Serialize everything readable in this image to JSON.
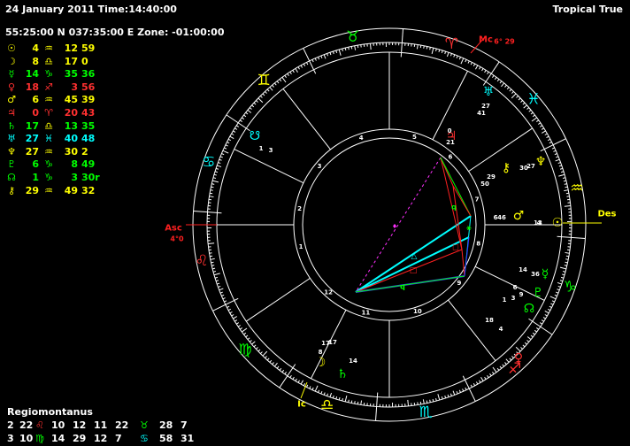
{
  "header": {
    "date_time": "24 January 2011 Time:14:40:00",
    "location": "55:25:00 N 037:35:00 E Zone: -01:00:00",
    "zodiac_mode": "Tropical True"
  },
  "colors": {
    "sun": "#ffff00",
    "moon": "#ffff00",
    "mercury": "#00ff00",
    "venus": "#ff3030",
    "mars": "#ffff00",
    "jupiter": "#ff3030",
    "saturn": "#00ff00",
    "uranus": "#00ffff",
    "neptune": "#ffff00",
    "pluto": "#00ff00",
    "node": "#00ff00",
    "chiron": "#ffff00",
    "fire": "#ff3030",
    "earth": "#00ff00",
    "air": "#ffff00",
    "water": "#00ffff",
    "aspect_cyan": "#00ffff",
    "aspect_red": "#ff2020",
    "aspect_blue": "#3030ff",
    "aspect_green": "#00ff00",
    "aspect_magenta": "#ff30ff"
  },
  "planets": [
    {
      "glyph": "☉",
      "deg": "4",
      "sign": "♒",
      "min": "12",
      "sec": "59",
      "color": "#ffff00",
      "sign_color": "#ffff00"
    },
    {
      "glyph": "☽",
      "deg": "8",
      "sign": "♎",
      "min": "17",
      "sec": "0",
      "color": "#ffff00",
      "sign_color": "#ffff00"
    },
    {
      "glyph": "☿",
      "deg": "14",
      "sign": "♑",
      "min": "35",
      "sec": "36",
      "color": "#00ff00",
      "sign_color": "#00ff00"
    },
    {
      "glyph": "♀",
      "deg": "18",
      "sign": "♐",
      "min": "3",
      "sec": "56",
      "color": "#ff3030",
      "sign_color": "#ff3030"
    },
    {
      "glyph": "♂",
      "deg": "6",
      "sign": "♒",
      "min": "45",
      "sec": "39",
      "color": "#ffff00",
      "sign_color": "#ffff00"
    },
    {
      "glyph": "♃",
      "deg": "0",
      "sign": "♈",
      "min": "20",
      "sec": "43",
      "color": "#ff3030",
      "sign_color": "#ff3030"
    },
    {
      "glyph": "♄",
      "deg": "17",
      "sign": "♎",
      "min": "13",
      "sec": "35",
      "color": "#00ff00",
      "sign_color": "#ffff00"
    },
    {
      "glyph": "♅",
      "deg": "27",
      "sign": "♓",
      "min": "40",
      "sec": "48",
      "color": "#00ffff",
      "sign_color": "#00ffff"
    },
    {
      "glyph": "♆",
      "deg": "27",
      "sign": "♒",
      "min": "30",
      "sec": "2",
      "color": "#ffff00",
      "sign_color": "#ffff00"
    },
    {
      "glyph": "♇",
      "deg": "6",
      "sign": "♑",
      "min": "8",
      "sec": "49",
      "color": "#00ff00",
      "sign_color": "#00ff00"
    },
    {
      "glyph": "☊",
      "deg": "1",
      "sign": "♑",
      "min": "3",
      "sec": "30r",
      "color": "#00ff00",
      "sign_color": "#00ff00"
    },
    {
      "glyph": "⚷",
      "deg": "29",
      "sign": "♒",
      "min": "49",
      "sec": "32",
      "color": "#ffff00",
      "sign_color": "#ffff00"
    }
  ],
  "house_system": "Regiomontanus",
  "house_cusps": [
    {
      "a_num": "2",
      "a_deg": "22",
      "a_sign": "♌",
      "a_min": "10",
      "a_sign_color": "#ff3030",
      "b_num": "12",
      "b_deg": "11",
      "b_min": "22",
      "b_sign": "♉",
      "b_deg2": "28",
      "b_min2": "7",
      "b_sign_color": "#00ff00"
    },
    {
      "a_num": "3",
      "a_deg": "10",
      "a_sign": "♍",
      "a_min": "14",
      "a_sign_color": "#00ff00",
      "b_num": "29",
      "b_deg": "12",
      "b_min": "7",
      "b_sign": "♋",
      "b_deg2": "58",
      "b_min2": "31",
      "b_sign_color": "#00ffff"
    }
  ],
  "angles": {
    "asc_label": "Asc",
    "asc_deg": "4°0",
    "mc_label": "Mc",
    "mc_deg": "6° 29",
    "des_label": "Des",
    "ic_label": "Ic"
  },
  "wheel_signs": [
    {
      "glyph": "♉",
      "color": "#00ff00"
    },
    {
      "glyph": "♈",
      "color": "#ff3030"
    },
    {
      "glyph": "♓",
      "color": "#00ffff"
    },
    {
      "glyph": "♒",
      "color": "#ffff00"
    },
    {
      "glyph": "♑",
      "color": "#00ff00"
    },
    {
      "glyph": "♐",
      "color": "#ff3030"
    },
    {
      "glyph": "♏",
      "color": "#00ffff"
    },
    {
      "glyph": "♎",
      "color": "#ffff00"
    },
    {
      "glyph": "♍",
      "color": "#00ff00"
    },
    {
      "glyph": "♌",
      "color": "#ff3030"
    },
    {
      "glyph": "♋",
      "color": "#00ffff"
    },
    {
      "glyph": "♊",
      "color": "#ffff00"
    }
  ],
  "house_numbers": [
    "1",
    "2",
    "3",
    "4",
    "5",
    "6",
    "7",
    "8",
    "9",
    "10",
    "11",
    "12"
  ],
  "wheel_planets": [
    {
      "name": "uranus",
      "glyph": "♅",
      "deg": "27",
      "min": "41",
      "color": "#00ffff"
    },
    {
      "name": "jupiter",
      "glyph": "♃",
      "deg": "0",
      "min": "21",
      "color": "#ff3030"
    },
    {
      "name": "chiron",
      "glyph": "⚷",
      "deg": "29",
      "min": "50",
      "color": "#ffff00"
    },
    {
      "name": "neptune",
      "glyph": "♆",
      "deg": "27",
      "min": "30",
      "color": "#ffff00"
    },
    {
      "name": "mars",
      "glyph": "♂",
      "deg": "6",
      "min": "46",
      "color": "#ffff00"
    },
    {
      "name": "sun",
      "glyph": "☉",
      "deg": "4",
      "min": "13",
      "color": "#ffff00"
    },
    {
      "name": "mercury",
      "glyph": "☿",
      "deg": "14",
      "min": "36",
      "color": "#00ff00"
    },
    {
      "name": "pluto",
      "glyph": "♇",
      "deg": "6",
      "min": "9",
      "color": "#00ff00"
    },
    {
      "name": "node",
      "glyph": "☊",
      "deg": "1",
      "min": "3",
      "color": "#00ff00"
    },
    {
      "name": "venus",
      "glyph": "♀",
      "deg": "18",
      "min": "4",
      "color": "#ff3030"
    },
    {
      "name": "saturn",
      "glyph": "♄",
      "deg": "17",
      "min": "14",
      "color": "#00ff00"
    },
    {
      "name": "moon",
      "glyph": "☽",
      "deg": "8",
      "min": "17",
      "color": "#ffff00"
    },
    {
      "name": "south-node",
      "glyph": "☋",
      "deg": "1",
      "min": "3",
      "color": "#00ffff"
    }
  ]
}
